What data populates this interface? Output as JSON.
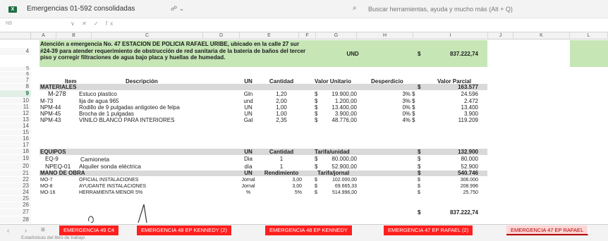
{
  "titlebar": {
    "app_icon": "X",
    "doc_title": "Emergencias 01-592 consolidadas",
    "share_icon": "share-icon",
    "search_placeholder": "Buscar herramientas, ayuda y mucho más (Alt + Q)"
  },
  "formulabar": {
    "namebox": "N9",
    "icons": "∨ ✕ ✓ fx"
  },
  "columns": [
    "A",
    "B",
    "C",
    "D",
    "E",
    "F",
    "G",
    "H",
    "I",
    "J",
    "K",
    "L"
  ],
  "rows_numbers": [
    "4",
    "5",
    "6",
    "7",
    "8",
    "9",
    "10",
    "11",
    "12",
    "13",
    "14",
    "15",
    "16",
    "17",
    "18",
    "19",
    "20",
    "21",
    "22",
    "23",
    "24",
    "25",
    "26",
    "27",
    "28"
  ],
  "header_block": {
    "description": "Atención a emergencia No. 47 ESTACION DE POLICIA RAFAEL URIBE, ubicado en la calle 27 sur #24-39 para atender requerimiento de obstrucción de red sanitaria de la batería de baños del tercer piso y corregir filtraciones de agua bajo placa y huellas de humedad.",
    "unit": "UND",
    "currency": "$",
    "total": "837.222,74"
  },
  "table_header": {
    "item": "Item",
    "descripcion": "Descripción",
    "un": "UN",
    "cantidad": "Cantidad",
    "valor_unitario": "Valor Unitario",
    "desperdicio": "Desperdicio",
    "valor_parcial": "Valor Parcial"
  },
  "materiales": {
    "title": "MATERIALES",
    "currency": "$",
    "total": "163.577",
    "items": [
      {
        "item": "M-278",
        "desc": "Estuco plastico",
        "un": "Gln",
        "cant": "1,20",
        "cur": "$",
        "vu": "19.900,00",
        "desp": "3%",
        "cur2": "$",
        "vp": "24.596"
      },
      {
        "item": "M-73",
        "desc": "lija de agua 965",
        "un": "und",
        "cant": "2,00",
        "cur": "$",
        "vu": "1.200,00",
        "desp": "3%",
        "cur2": "$",
        "vp": "2.472"
      },
      {
        "item": "NPM-44",
        "desc": "Rodillo de 9 pulgadas antigoteo de felpa",
        "un": "UN",
        "cant": "1,00",
        "cur": "$",
        "vu": "13.400,00",
        "desp": "0%",
        "cur2": "$",
        "vp": "13.400"
      },
      {
        "item": "NPM-45",
        "desc": "Brocha de 1 pulgadas",
        "un": "UN",
        "cant": "1,00",
        "cur": "$",
        "vu": "3.900,00",
        "desp": "0%",
        "cur2": "$",
        "vp": "3.900"
      },
      {
        "item": "NPM-43",
        "desc": "VINILO BLANCO PARA INTERIORES",
        "un": "Gal",
        "cant": "2,35",
        "cur": "$",
        "vu": "48.776,00",
        "desp": "4%",
        "cur2": "$",
        "vp": "119.209"
      }
    ]
  },
  "equipos": {
    "title": "EQUIPOS",
    "un": "UN",
    "cantidad": "Cantidad",
    "tarifa": "Tarifa/unidad",
    "currency": "$",
    "total": "132.900",
    "items": [
      {
        "item": "EQ-9",
        "desc": "Camioneta",
        "un": "Dia",
        "cant": "1",
        "cur": "$",
        "vu": "80.000,00",
        "cur2": "$",
        "vp": "80.000"
      },
      {
        "item": "NPEQ-01",
        "desc": "Alquiler sonda eléctrica",
        "un": "día",
        "cant": "1",
        "cur": "$",
        "vu": "52.900,00",
        "cur2": "$",
        "vp": "52.900"
      }
    ]
  },
  "mano_obra": {
    "title": "MANO DE OBRA",
    "un": "UN",
    "rendimiento": "Rendimiento",
    "tarifa": "Tarifa/jornal",
    "currency": "$",
    "total": "540.746",
    "items": [
      {
        "item": "MO-7",
        "desc": "OFICIAL INSTALACIONES",
        "un": "Jornal",
        "cant": "3,00",
        "cur": "$",
        "vu": "102.000,00",
        "cur2": "$",
        "vp": "306.000"
      },
      {
        "item": "MO-8",
        "desc": "AYUDANTE INSTALACIONES",
        "un": "Jornal",
        "cant": "3,00",
        "cur": "$",
        "vu": "69.665,33",
        "cur2": "$",
        "vp": "208.996"
      },
      {
        "item": "MO-16",
        "desc": "HERRAMIENTA MENOR 5%",
        "un": "%",
        "cant": "5%",
        "cur": "$",
        "vu": "514.996,00",
        "cur2": "$",
        "vp": "25.750"
      }
    ]
  },
  "grand_total": {
    "currency": "$",
    "value": "837.222,74"
  },
  "tabs": [
    {
      "label": "EMERGENCIA 49 C4",
      "active": false
    },
    {
      "label": "EMERGENCIA 48 EP KENNEDY (2)",
      "active": false
    },
    {
      "label": "EMERGENCIA 48 EP KENNEDY",
      "active": false
    },
    {
      "label": "EMERGENCIA 47 EP RAFAEL  (2)",
      "active": false
    },
    {
      "label": "EMERGENCIA 47 EP RAFAEL",
      "active": true
    }
  ],
  "status": {
    "text": "Estadísticas del libro de trabajo"
  }
}
